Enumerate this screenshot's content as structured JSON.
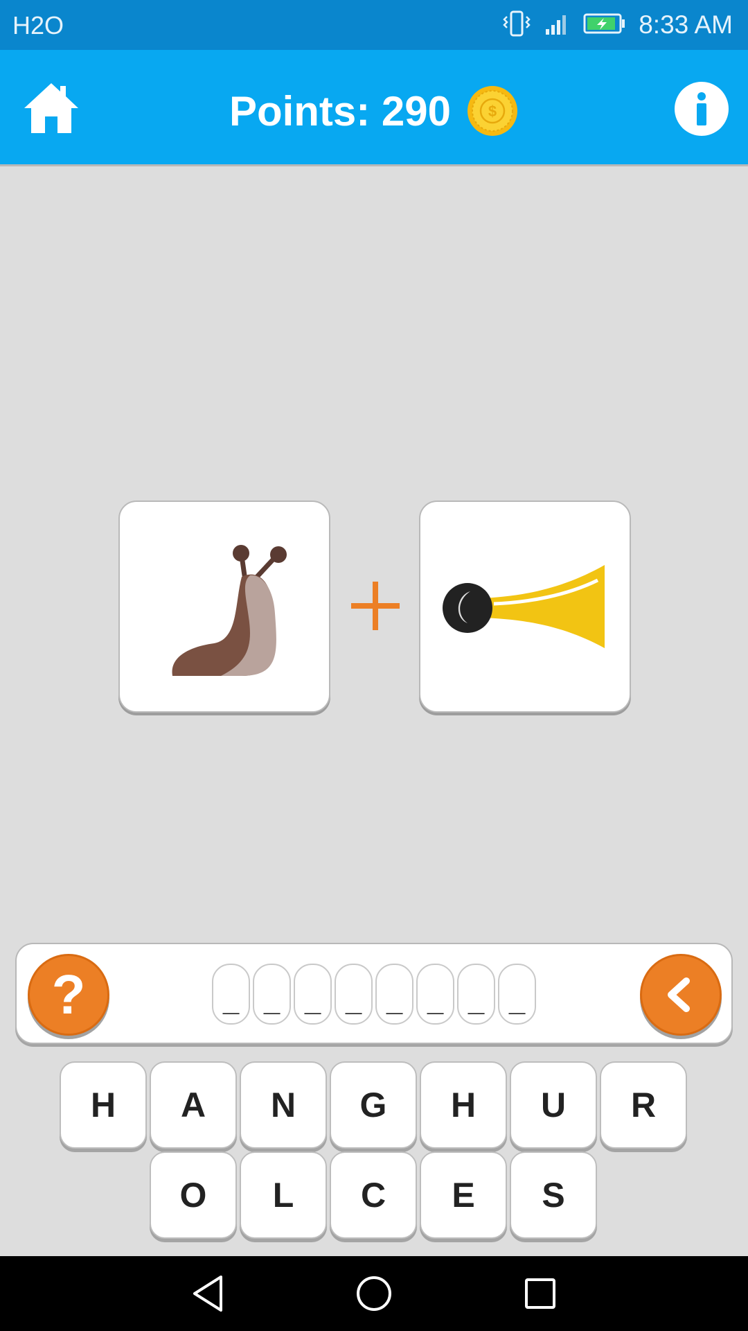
{
  "status_bar": {
    "carrier": "H2O",
    "time": "8:33 AM",
    "icons": [
      "vibrate-icon",
      "signal-icon",
      "battery-charging-icon"
    ]
  },
  "header": {
    "home_icon": "home-icon",
    "points_label": "Points: 290",
    "coin_icon": "coin-icon",
    "info_icon": "info-icon"
  },
  "puzzle": {
    "left_image": "slug-icon",
    "operator": "+",
    "right_image": "horn-icon"
  },
  "answer": {
    "hint_label": "?",
    "slots": [
      "_",
      "_",
      "_",
      "_",
      "_",
      "_",
      "_",
      "_"
    ],
    "backspace_icon": "chevron-left-icon"
  },
  "keyboard": {
    "row1": [
      "H",
      "A",
      "N",
      "G",
      "H",
      "U",
      "R"
    ],
    "row2": [
      "O",
      "L",
      "C",
      "E",
      "S"
    ]
  },
  "nav_bar": {
    "icons": [
      "back-triangle-icon",
      "home-circle-icon",
      "recents-square-icon"
    ]
  },
  "colors": {
    "status_bar": "#0a86cd",
    "app_bar": "#08a8f1",
    "accent_orange": "#ec7f25",
    "background": "#dddddd"
  }
}
